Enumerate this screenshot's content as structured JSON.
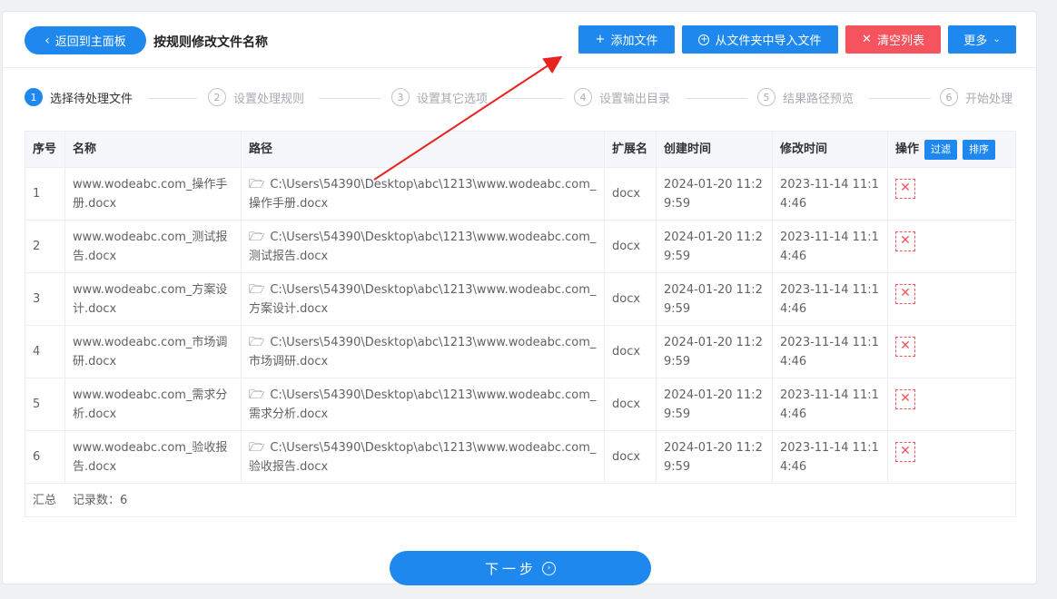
{
  "header": {
    "back_label": "返回到主面板",
    "title": "按规则修改文件名称",
    "add_label": "添加文件",
    "import_label": "从文件夹中导入文件",
    "clear_label": "清空列表",
    "more_label": "更多"
  },
  "steps": [
    {
      "num": "1",
      "label": "选择待处理文件"
    },
    {
      "num": "2",
      "label": "设置处理规则"
    },
    {
      "num": "3",
      "label": "设置其它选项"
    },
    {
      "num": "4",
      "label": "设置输出目录"
    },
    {
      "num": "5",
      "label": "结果路径预览"
    },
    {
      "num": "6",
      "label": "开始处理"
    }
  ],
  "table": {
    "headers": {
      "idx": "序号",
      "name": "名称",
      "path": "路径",
      "ext": "扩展名",
      "ctime": "创建时间",
      "mtime": "修改时间",
      "op": "操作",
      "filter": "过滤",
      "sort": "排序"
    },
    "rows": [
      {
        "idx": "1",
        "name": "www.wodeabc.com_操作手册.docx",
        "path": "C:\\Users\\54390\\Desktop\\abc\\1213\\www.wodeabc.com_操作手册.docx",
        "ext": "docx",
        "ctime": "2024-01-20 11:29:59",
        "mtime": "2023-11-14 11:14:46"
      },
      {
        "idx": "2",
        "name": "www.wodeabc.com_测试报告.docx",
        "path": "C:\\Users\\54390\\Desktop\\abc\\1213\\www.wodeabc.com_测试报告.docx",
        "ext": "docx",
        "ctime": "2024-01-20 11:29:59",
        "mtime": "2023-11-14 11:14:46"
      },
      {
        "idx": "3",
        "name": "www.wodeabc.com_方案设计.docx",
        "path": "C:\\Users\\54390\\Desktop\\abc\\1213\\www.wodeabc.com_方案设计.docx",
        "ext": "docx",
        "ctime": "2024-01-20 11:29:59",
        "mtime": "2023-11-14 11:14:46"
      },
      {
        "idx": "4",
        "name": "www.wodeabc.com_市场调研.docx",
        "path": "C:\\Users\\54390\\Desktop\\abc\\1213\\www.wodeabc.com_市场调研.docx",
        "ext": "docx",
        "ctime": "2024-01-20 11:29:59",
        "mtime": "2023-11-14 11:14:46"
      },
      {
        "idx": "5",
        "name": "www.wodeabc.com_需求分析.docx",
        "path": "C:\\Users\\54390\\Desktop\\abc\\1213\\www.wodeabc.com_需求分析.docx",
        "ext": "docx",
        "ctime": "2024-01-20 11:29:59",
        "mtime": "2023-11-14 11:14:46"
      },
      {
        "idx": "6",
        "name": "www.wodeabc.com_验收报告.docx",
        "path": "C:\\Users\\54390\\Desktop\\abc\\1213\\www.wodeabc.com_验收报告.docx",
        "ext": "docx",
        "ctime": "2024-01-20 11:29:59",
        "mtime": "2023-11-14 11:14:46"
      }
    ],
    "footer": {
      "summary_label": "汇总",
      "count_text": "记录数：6"
    }
  },
  "next_label": "下一步",
  "icons": {
    "back": "chevron-left-icon",
    "add": "plus-icon",
    "import": "circle-plus-icon",
    "clear": "close-icon",
    "more": "chevron-down-icon",
    "folder": "folder-icon",
    "delete": "close-icon",
    "next": "circle-arrow-right-icon"
  },
  "colors": {
    "primary": "#1e88ef",
    "danger": "#f5535d",
    "annotation_arrow": "#e8231f"
  }
}
